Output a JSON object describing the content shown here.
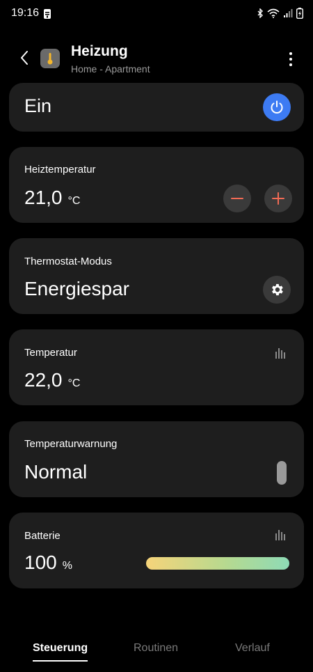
{
  "status_bar": {
    "time": "19:16"
  },
  "header": {
    "title": "Heizung",
    "subtitle": "Home - Apartment"
  },
  "power_card": {
    "state_label": "Ein",
    "accent_color": "#3d7bf3"
  },
  "heating_temp_card": {
    "label": "Heiztemperatur",
    "value": "21,0",
    "unit": "°C",
    "stepper_color": "#f26b55"
  },
  "mode_card": {
    "label": "Thermostat-Modus",
    "value": "Energiespar"
  },
  "temperature_card": {
    "label": "Temperatur",
    "value": "22,0",
    "unit": "°C"
  },
  "warning_card": {
    "label": "Temperaturwarnung",
    "value": "Normal"
  },
  "battery_card": {
    "label": "Batterie",
    "value": "100",
    "unit": "%",
    "level_percent": 100
  },
  "tabs": [
    {
      "label": "Steuerung",
      "active": true
    },
    {
      "label": "Routinen",
      "active": false
    },
    {
      "label": "Verlauf",
      "active": false
    }
  ],
  "icons": {
    "back": "chevron-left-icon",
    "device": "thermometer-icon",
    "more": "more-vertical-icon",
    "power": "power-icon",
    "minus": "minus-icon",
    "plus": "plus-icon",
    "settings": "gear-icon",
    "history": "bar-chart-icon"
  }
}
